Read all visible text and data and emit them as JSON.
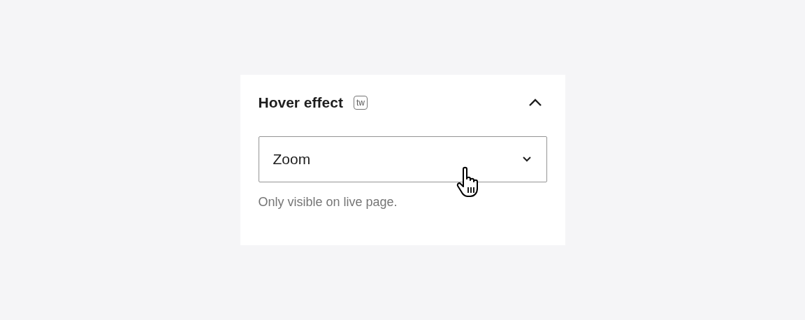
{
  "panel": {
    "title": "Hover effect",
    "badge": "tw",
    "expanded": true,
    "select": {
      "value": "Zoom"
    },
    "help": "Only visible on live page."
  }
}
